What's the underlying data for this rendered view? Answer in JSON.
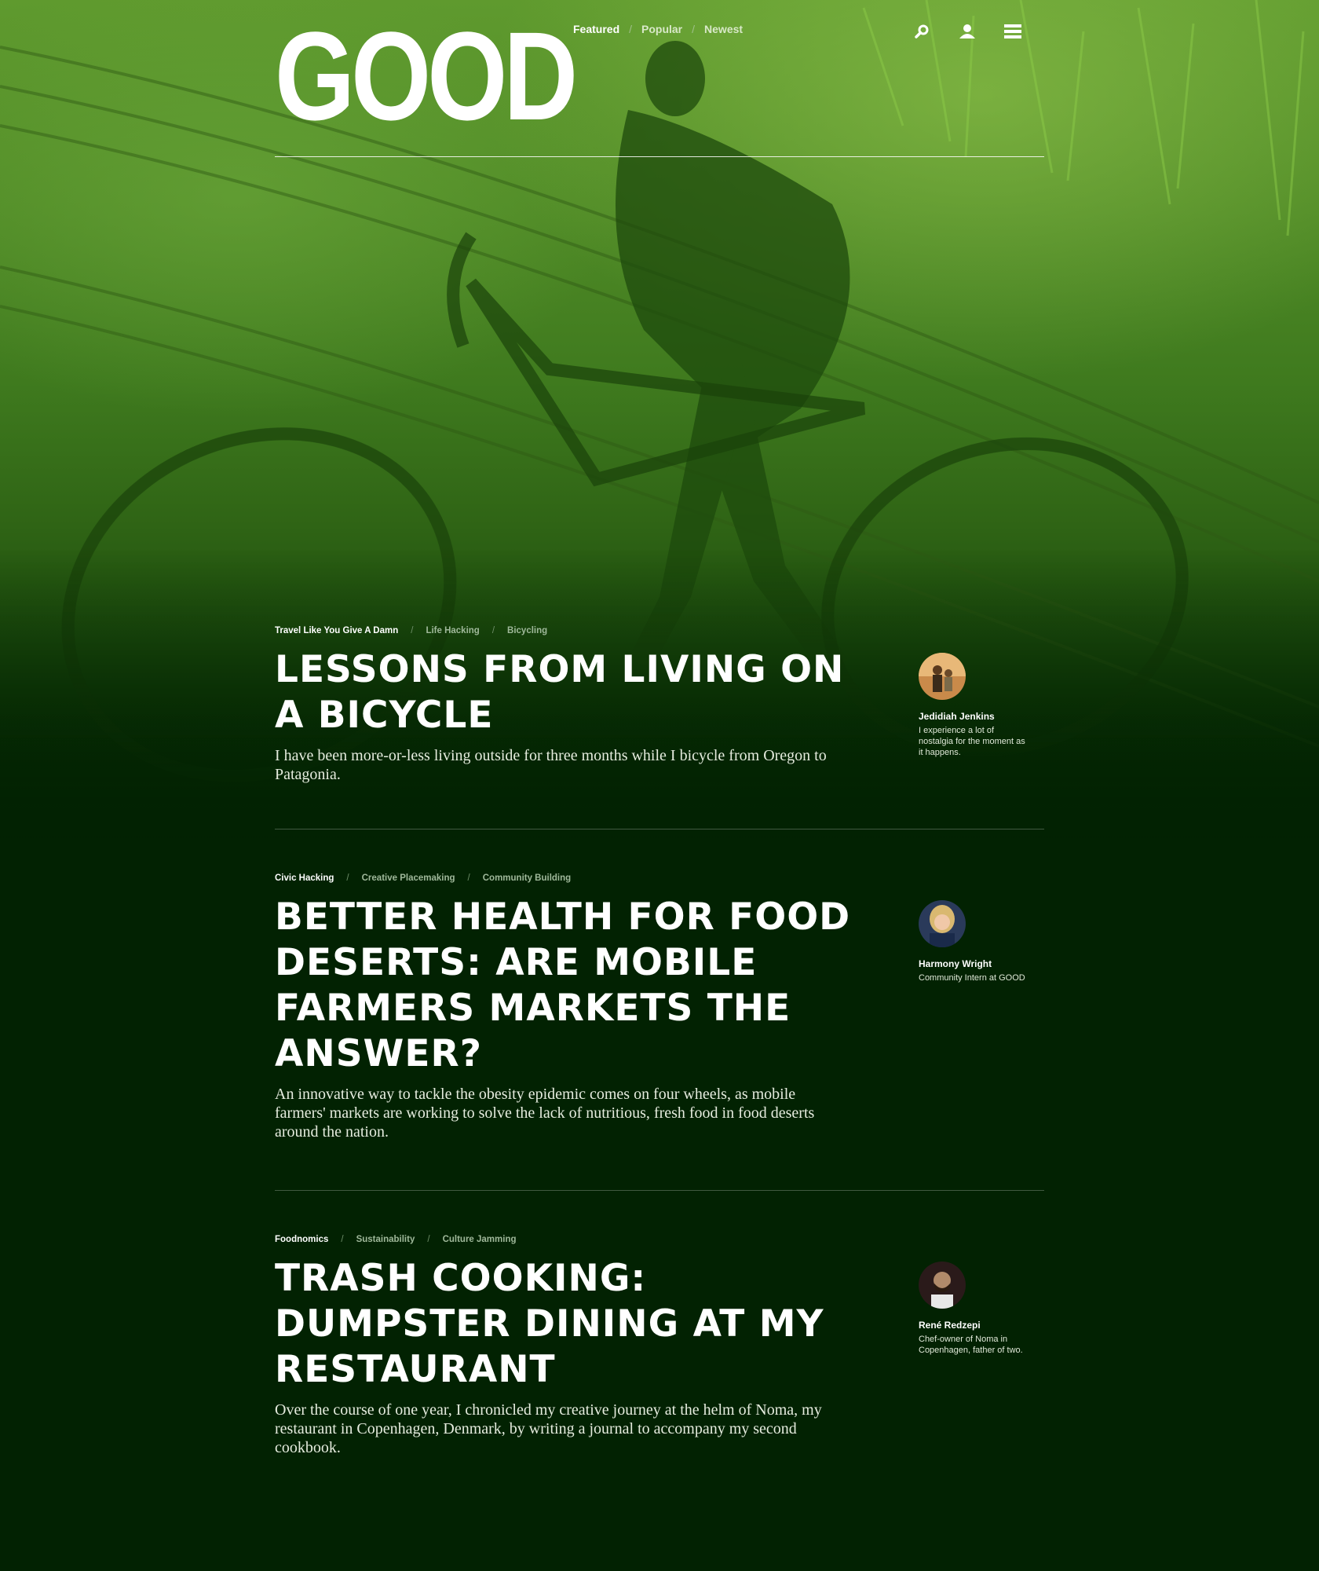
{
  "site": {
    "logo": "GOOD",
    "nav": [
      {
        "label": "Featured",
        "active": true
      },
      {
        "label": "Popular",
        "active": false
      },
      {
        "label": "Newest",
        "active": false
      }
    ],
    "nav_separator": "/",
    "icons": [
      "search-icon",
      "user-icon",
      "menu-icon"
    ]
  },
  "articles": [
    {
      "tags": [
        "Travel Like You Give A Damn",
        "Life Hacking",
        "Bicycling"
      ],
      "title": "Lessons from Living on a Bicycle",
      "dek": "I have been more-or-less living outside for three months while I bicycle from Oregon to Patagonia.",
      "author": {
        "name": "Jedidiah Jenkins",
        "bio": "I experience a lot of nostalgia for the moment as it happens."
      }
    },
    {
      "tags": [
        "Civic Hacking",
        "Creative Placemaking",
        "Community Building"
      ],
      "title": "Better Health for Food Deserts: Are Mobile Farmers Markets the Answer?",
      "dek": "An innovative way to tackle the obesity epidemic comes on four wheels, as mobile farmers' markets are working to solve the lack of nutritious, fresh food in food deserts around the nation.",
      "author": {
        "name": "Harmony Wright",
        "bio": "Community Intern at GOOD"
      }
    },
    {
      "tags": [
        "Foodnomics",
        "Sustainability",
        "Culture Jamming"
      ],
      "title": "Trash Cooking: Dumpster Dining at My Restaurant",
      "dek": "Over the course of one year, I chronicled my creative journey at the helm of Noma, my restaurant in Copenhagen, Denmark, by writing a journal to accompany my second cookbook.",
      "author": {
        "name": "René Redzepi",
        "bio": "Chef-owner of Noma in Copenhagen, father of two."
      }
    }
  ],
  "colors": {
    "background": "#022202",
    "hero_green": "#4f8a26",
    "text": "#ffffff"
  }
}
